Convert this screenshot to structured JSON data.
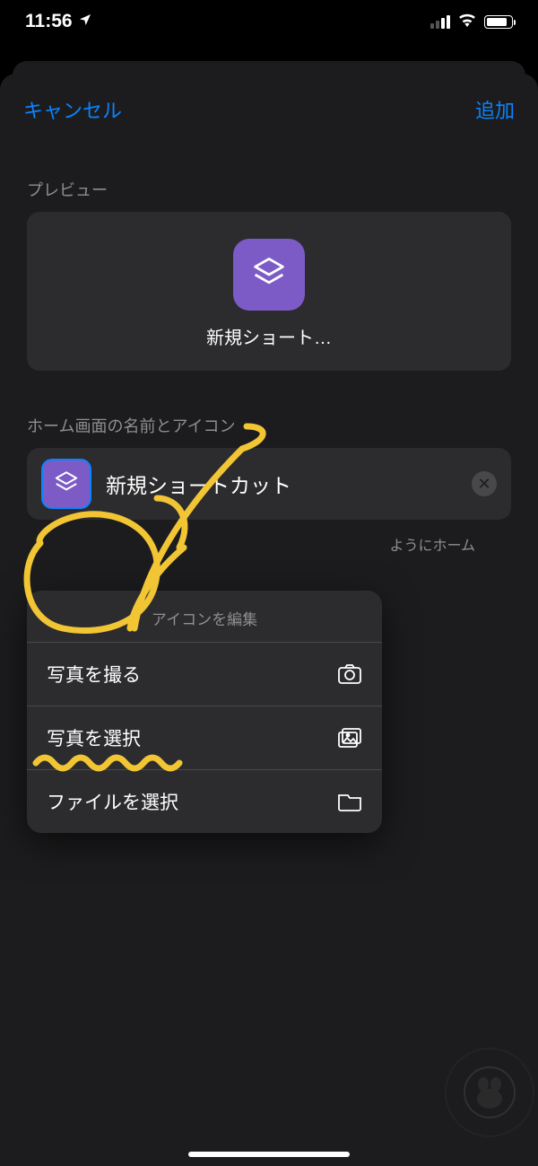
{
  "status": {
    "time": "11:56",
    "location_icon": "location-arrow"
  },
  "header": {
    "cancel": "キャンセル",
    "add": "追加"
  },
  "preview": {
    "section_label": "プレビュー",
    "shortcut_name_truncated": "新規ショート…",
    "icon_color": "#7d5bc6"
  },
  "name_section": {
    "section_label": "ホーム画面の名前とアイコン",
    "value": "新規ショートカット",
    "help_visible_fragment": "ようにホーム"
  },
  "popup": {
    "title": "アイコンを編集",
    "items": [
      {
        "label": "写真を撮る",
        "icon": "camera"
      },
      {
        "label": "写真を選択",
        "icon": "photo-library"
      },
      {
        "label": "ファイルを選択",
        "icon": "folder"
      }
    ]
  },
  "colors": {
    "accent": "#0a84ff",
    "icon_bg": "#7d5bc6",
    "annotation": "#f2c534"
  }
}
